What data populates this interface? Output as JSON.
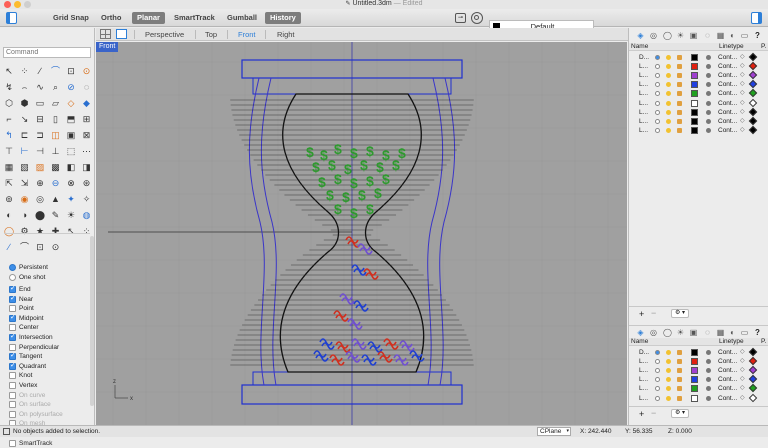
{
  "window": {
    "title": "Untitled.3dm",
    "edited_label": "— Edited"
  },
  "toolbar": {
    "grid_snap": "Grid Snap",
    "ortho": "Ortho",
    "planar": "Planar",
    "smarttrack": "SmartTrack",
    "gumball": "Gumball",
    "history": "History",
    "active_buttons": [
      "Planar",
      "History"
    ],
    "current_layer": "Default"
  },
  "command": {
    "placeholder": "Command"
  },
  "viewport_tabs": [
    "Perspective",
    "Top",
    "Front",
    "Right"
  ],
  "active_viewport": "Front",
  "viewport": {
    "label": "Front",
    "axis_x": "x",
    "axis_z": "z"
  },
  "osnap": {
    "persistent": "Persistent",
    "one_shot": "One shot",
    "mode": "Persistent",
    "items": [
      {
        "label": "End",
        "checked": true,
        "enabled": true
      },
      {
        "label": "Near",
        "checked": true,
        "enabled": true
      },
      {
        "label": "Point",
        "checked": false,
        "enabled": true
      },
      {
        "label": "Midpoint",
        "checked": true,
        "enabled": true
      },
      {
        "label": "Center",
        "checked": false,
        "enabled": true
      },
      {
        "label": "Intersection",
        "checked": true,
        "enabled": true
      },
      {
        "label": "Perpendicular",
        "checked": false,
        "enabled": true
      },
      {
        "label": "Tangent",
        "checked": true,
        "enabled": true
      },
      {
        "label": "Quadrant",
        "checked": true,
        "enabled": true
      },
      {
        "label": "Knot",
        "checked": false,
        "enabled": true
      },
      {
        "label": "Vertex",
        "checked": false,
        "enabled": true
      },
      {
        "label": "On curve",
        "checked": false,
        "enabled": false
      },
      {
        "label": "On surface",
        "checked": false,
        "enabled": false
      },
      {
        "label": "On polysurface",
        "checked": false,
        "enabled": false
      },
      {
        "label": "On mesh",
        "checked": false,
        "enabled": false
      },
      {
        "label": "Project",
        "checked": false,
        "enabled": true
      },
      {
        "label": "SmartTrack",
        "checked": false,
        "enabled": true
      }
    ]
  },
  "layers_panel": {
    "col_name": "Name",
    "col_linetype": "Linetype",
    "col_print": "P.",
    "rows": [
      {
        "name": "D...",
        "color": "#000000",
        "linetype": "Cont...",
        "current": true
      },
      {
        "name": "L...",
        "color": "#e02010",
        "linetype": "Cont...",
        "current": false
      },
      {
        "name": "L...",
        "color": "#a040d0",
        "linetype": "Cont...",
        "current": false
      },
      {
        "name": "L...",
        "color": "#2040e0",
        "linetype": "Cont...",
        "current": false
      },
      {
        "name": "L...",
        "color": "#20a020",
        "linetype": "Cont...",
        "current": false
      },
      {
        "name": "L...",
        "color": "#ffffff",
        "linetype": "Cont...",
        "current": false
      },
      {
        "name": "L...",
        "color": "#000000",
        "linetype": "Cont...",
        "current": false
      },
      {
        "name": "L...",
        "color": "#000000",
        "linetype": "Cont...",
        "current": false
      },
      {
        "name": "L...",
        "color": "#000000",
        "linetype": "Cont...",
        "current": false
      }
    ]
  },
  "layers_panel_2": {
    "col_name": "Name",
    "col_linetype": "Linetype",
    "col_print": "P.",
    "rows": [
      {
        "name": "D...",
        "color": "#000000",
        "linetype": "Cont...",
        "current": true
      },
      {
        "name": "L...",
        "color": "#e02010",
        "linetype": "Cont...",
        "current": false
      },
      {
        "name": "L...",
        "color": "#a040d0",
        "linetype": "Cont...",
        "current": false
      },
      {
        "name": "L...",
        "color": "#2040e0",
        "linetype": "Cont...",
        "current": false
      },
      {
        "name": "L...",
        "color": "#20a020",
        "linetype": "Cont...",
        "current": false
      },
      {
        "name": "L...",
        "color": "#ffffff",
        "linetype": "Cont...",
        "current": false
      }
    ]
  },
  "status": {
    "message": "No objects added to selection.",
    "cplane": "CPlane",
    "x": "X: 242.440",
    "y": "Y: 56.335",
    "z": "Z: 0.000"
  }
}
